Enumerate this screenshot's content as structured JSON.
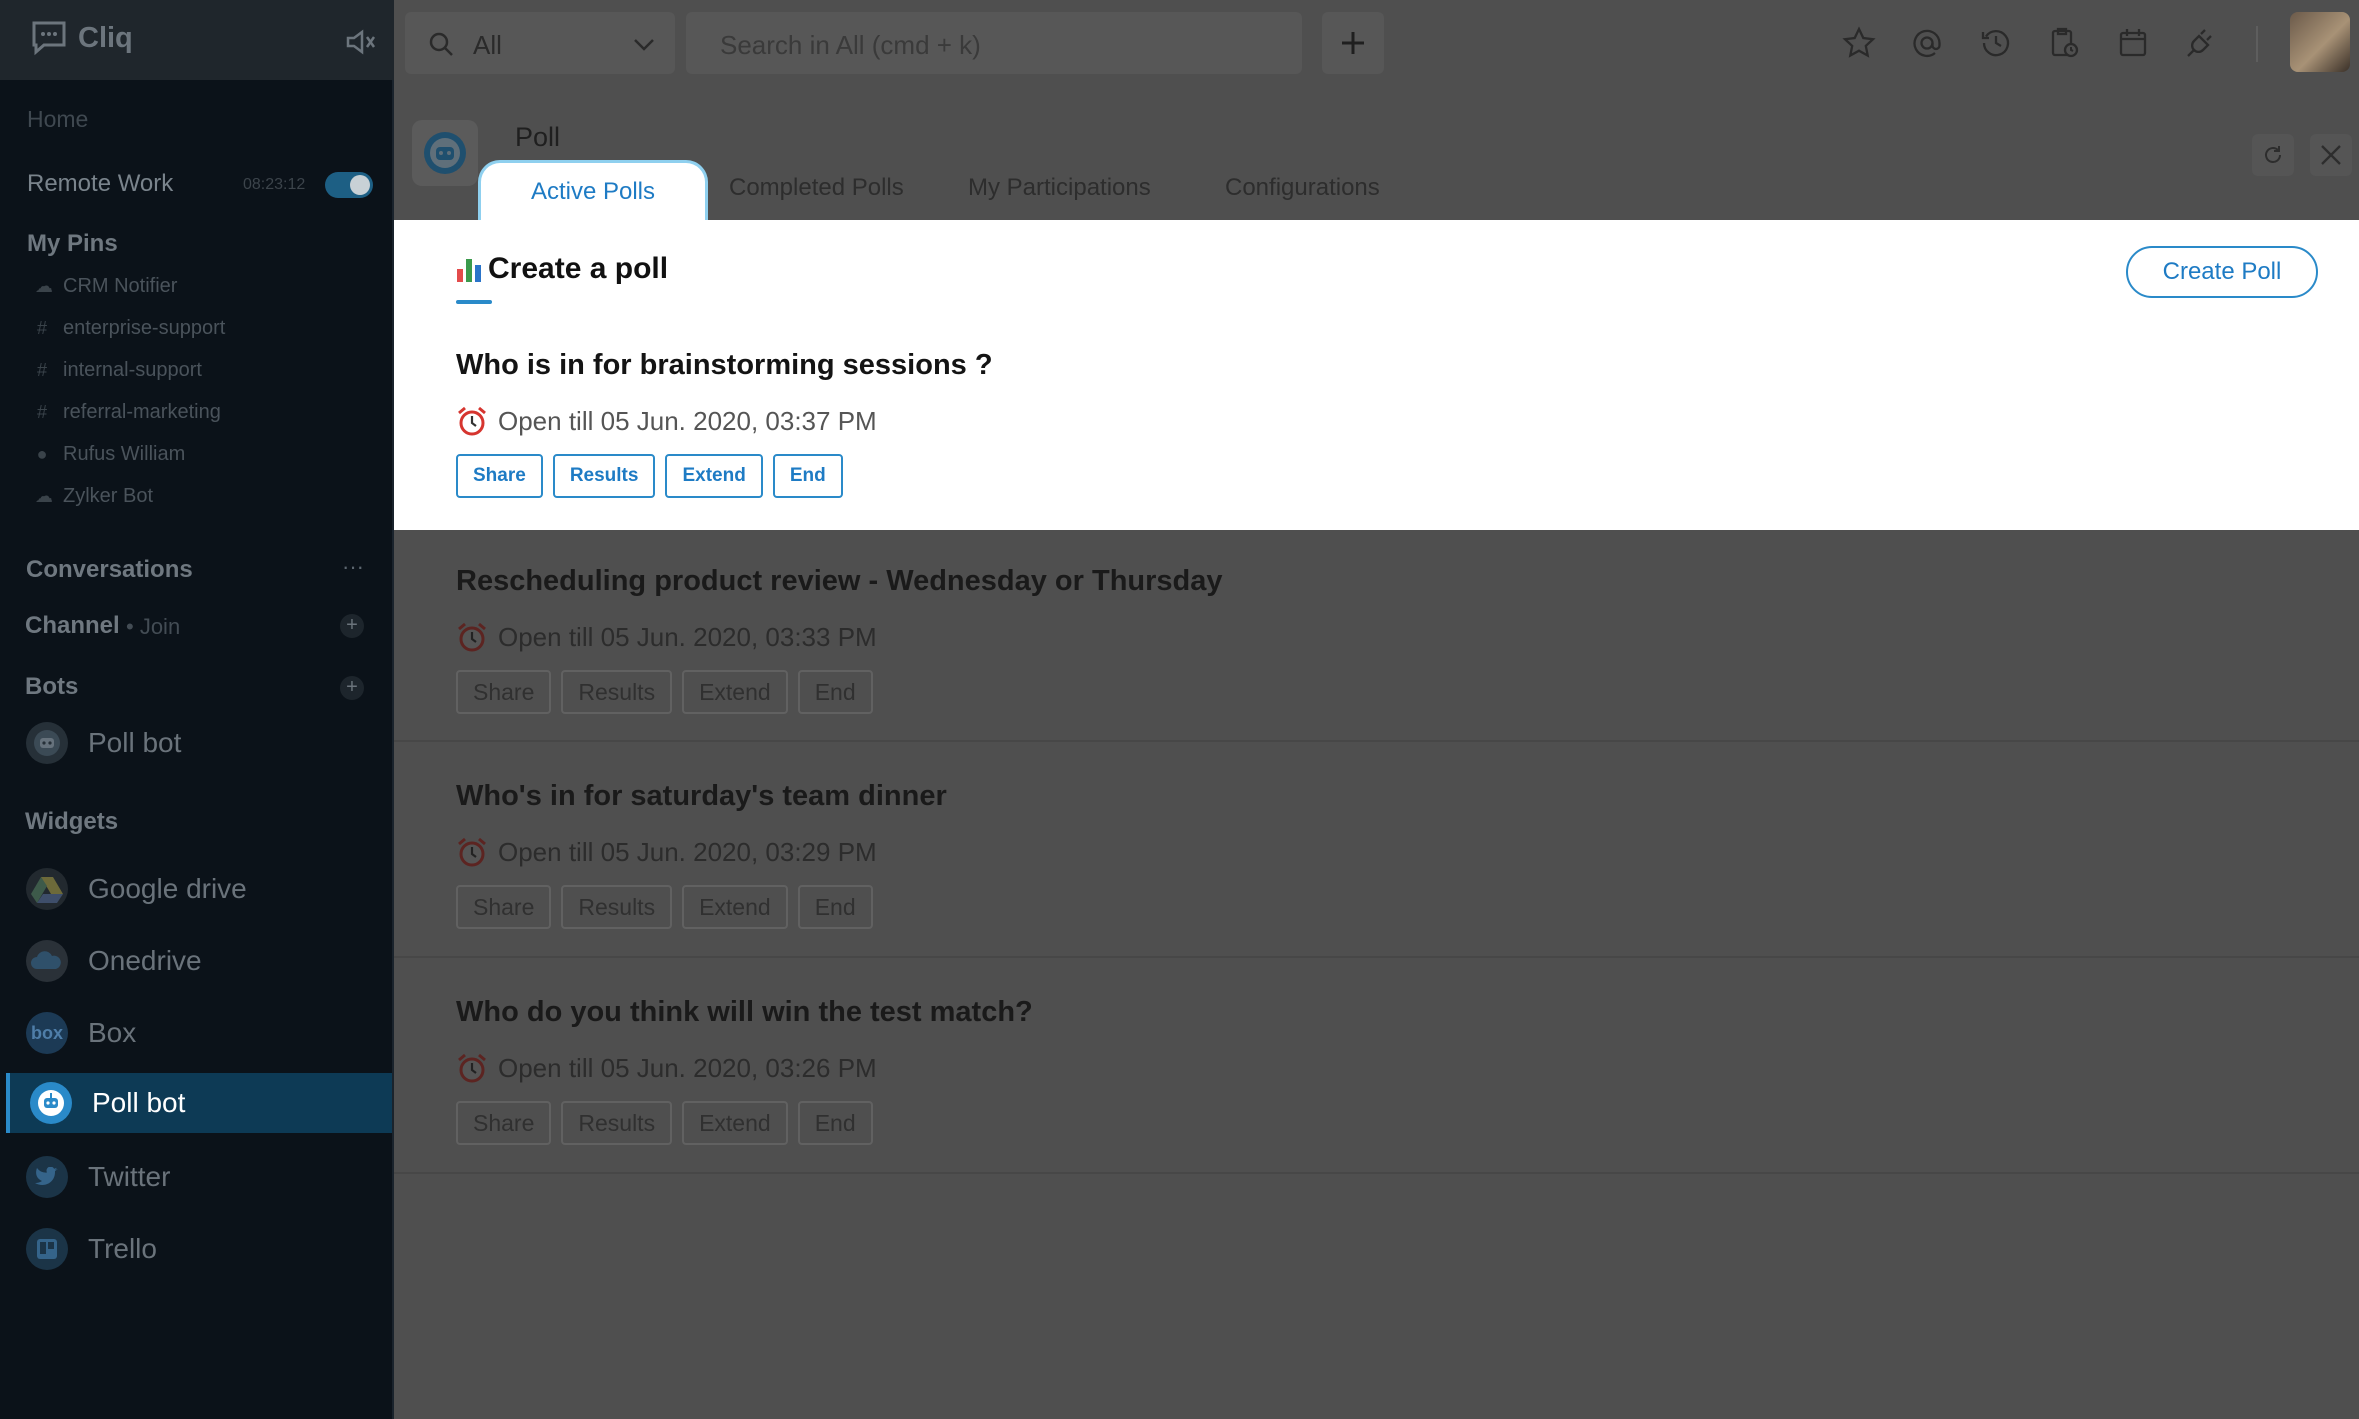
{
  "app": {
    "name": "Cliq"
  },
  "sidebar": {
    "home": "Home",
    "remote_work": {
      "label": "Remote Work",
      "timer": "08:23:12"
    },
    "my_pins_title": "My Pins",
    "pins": [
      {
        "label": "CRM Notifier",
        "icon": "cloud-icon"
      },
      {
        "label": "enterprise-support",
        "icon": "hash-icon"
      },
      {
        "label": "internal-support",
        "icon": "hash-icon"
      },
      {
        "label": "referral-marketing",
        "icon": "hash-icon"
      },
      {
        "label": "Rufus William",
        "icon": "status-dot-icon"
      },
      {
        "label": "Zylker Bot",
        "icon": "cloud-icon"
      }
    ],
    "conversations": "Conversations",
    "conversations_more": "···",
    "channel": "Channel",
    "channel_join": "• Join",
    "bots": "Bots",
    "bots_items": [
      "Poll bot"
    ],
    "widgets": "Widgets",
    "widget_items": [
      "Google drive",
      "Onedrive",
      "Box",
      "Poll bot",
      "Twitter",
      "Trello"
    ],
    "box_logo_text": "box"
  },
  "topbar": {
    "scope": "All",
    "search_placeholder": "Search in All (cmd + k)",
    "icons": [
      "star-icon",
      "mention-icon",
      "history-icon",
      "reminder-icon",
      "calendar-icon",
      "integrations-icon"
    ]
  },
  "panel": {
    "title": "Poll",
    "tabs": [
      "Active Polls",
      "Completed Polls",
      "My Participations",
      "Configurations"
    ]
  },
  "create": {
    "title": "Create a poll",
    "button": "Create Poll"
  },
  "poll_actions": [
    "Share",
    "Results",
    "Extend",
    "End"
  ],
  "polls": [
    {
      "question": "Who is in for brainstorming sessions ?",
      "open_till": "Open till 05 Jun. 2020, 03:37 PM"
    },
    {
      "question": "Rescheduling  product review - Wednesday  or  Thursday",
      "open_till": "Open till 05 Jun. 2020, 03:33 PM"
    },
    {
      "question": "Who's in for saturday's team dinner",
      "open_till": "Open till 05 Jun. 2020, 03:29 PM"
    },
    {
      "question": "Who do you think  will win the test match?",
      "open_till": "Open till 05 Jun. 2020, 03:26 PM"
    }
  ],
  "colors": {
    "accent": "#2a8ac9",
    "active_sidebar": "#0d3a55",
    "overlay": "#4f4f4f"
  }
}
